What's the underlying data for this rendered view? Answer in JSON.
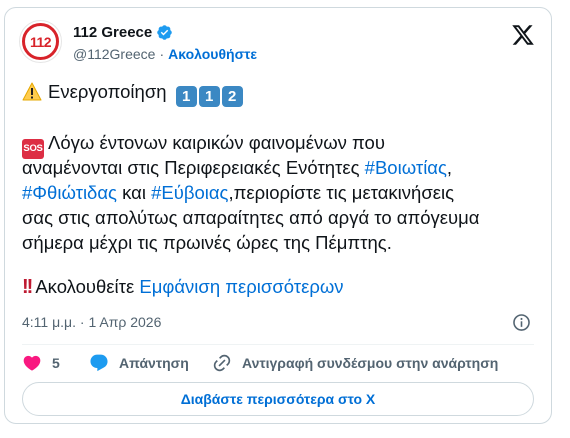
{
  "author": {
    "display_name": "112 Greece",
    "handle": "@112Greece",
    "separator": "·",
    "follow_label": "Ακολουθήστε",
    "avatar_text": "112"
  },
  "tweet": {
    "line1_text": "Ενεργοποίηση",
    "line1_digits": [
      "1",
      "1",
      "2"
    ],
    "sos_label": "SOS",
    "body_line1": "Λόγω έντονων καιρικών φαινομένων που",
    "body_line2_prefix": "αναμένονται στις Περιφερειακές Ενότητες ",
    "hashtag_boiotias": "#Βοιωτίας",
    "body_line2_suffix": ",",
    "hashtag_fthiotidas": "#Φθιώτιδας",
    "body_line3_mid": " και ",
    "hashtag_evoias": "#Εύβοιας",
    "body_line3_suffix": ",περιορίστε τις μετακινήσεις",
    "body_line4": "σας στις απολύτως απαραίτητες από αργά το απόγευμα",
    "body_line5": "σήμερα μέχρι τις πρωινές ώρες της Πέμπτης.",
    "last_line_text": "Ακολουθείτε",
    "show_more_label": "Εμφάνιση περισσότερων",
    "timestamp": "4:11 μ.μ. · 1 Απρ 2026"
  },
  "actions": {
    "likes_count": "5",
    "reply_label": "Απάντηση",
    "copy_link_label": "Αντιγραφή συνδέσμου στην ανάρτηση"
  },
  "read_more_label": "Διαβάστε περισσότερα στο X",
  "colors": {
    "accent": "#006fd6",
    "like": "#f91880",
    "brand_red": "#d8232a"
  }
}
